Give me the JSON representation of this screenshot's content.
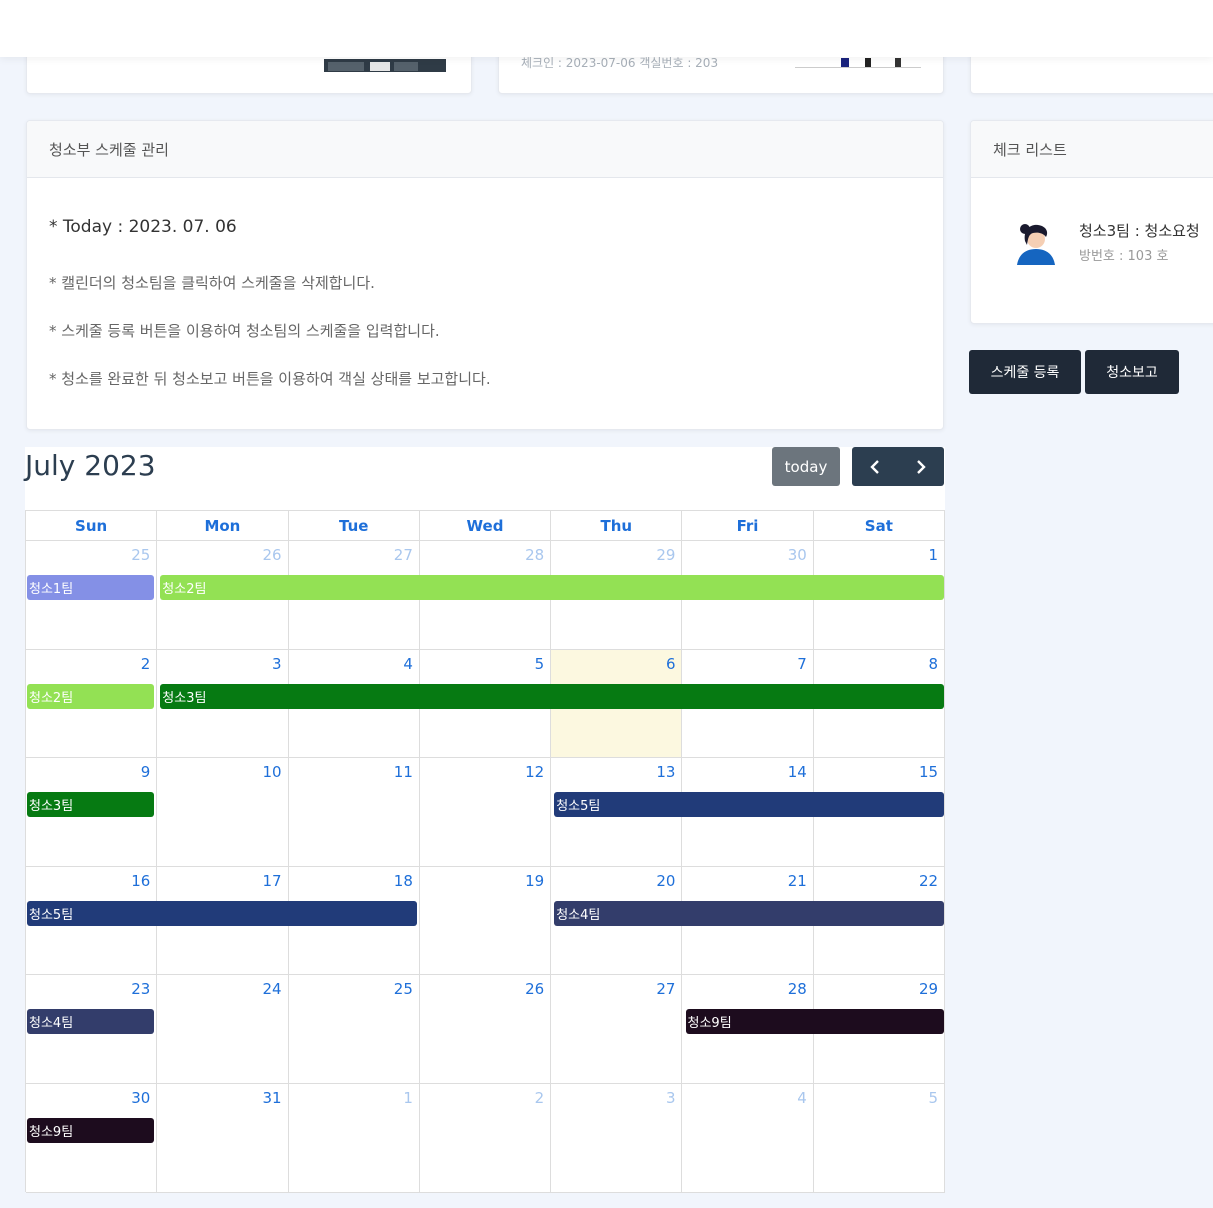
{
  "top_cards": {
    "card2_text": "체크인 : 2023-07-06 객실번호 : 203"
  },
  "schedule": {
    "header": "청소부 스케줄 관리",
    "today": "* Today : 2023. 07. 06",
    "info": [
      "* 캘린더의 청소팀을 클릭하여 스케줄을 삭제합니다.",
      "* 스케줄 등록 버튼을 이용하여 청소팀의 스케줄을 입력합니다.",
      "* 청소를 완료한 뒤 청소보고 버튼을 이용하여 객실 상태를 보고합니다."
    ]
  },
  "checklist": {
    "header": "체크 리스트",
    "item_title": "청소3팀 : 청소요청",
    "item_sub": "방번호 : 103 호"
  },
  "buttons": {
    "register": "스케줄 등록",
    "report": "청소보고"
  },
  "calendar": {
    "title": "July 2023",
    "today_label": "today",
    "prev_icon": "chevron-left-icon",
    "next_icon": "chevron-right-icon",
    "dow": [
      "Sun",
      "Mon",
      "Tue",
      "Wed",
      "Thu",
      "Fri",
      "Sat"
    ],
    "today_date": "2023-07-06",
    "weeks": [
      [
        {
          "d": "25",
          "other": true
        },
        {
          "d": "26",
          "other": true
        },
        {
          "d": "27",
          "other": true
        },
        {
          "d": "28",
          "other": true
        },
        {
          "d": "29",
          "other": true
        },
        {
          "d": "30",
          "other": true
        },
        {
          "d": "1"
        }
      ],
      [
        {
          "d": "2"
        },
        {
          "d": "3"
        },
        {
          "d": "4"
        },
        {
          "d": "5"
        },
        {
          "d": "6",
          "today": true
        },
        {
          "d": "7"
        },
        {
          "d": "8"
        }
      ],
      [
        {
          "d": "9"
        },
        {
          "d": "10"
        },
        {
          "d": "11"
        },
        {
          "d": "12"
        },
        {
          "d": "13"
        },
        {
          "d": "14"
        },
        {
          "d": "15"
        }
      ],
      [
        {
          "d": "16"
        },
        {
          "d": "17"
        },
        {
          "d": "18"
        },
        {
          "d": "19"
        },
        {
          "d": "20"
        },
        {
          "d": "21"
        },
        {
          "d": "22"
        }
      ],
      [
        {
          "d": "23"
        },
        {
          "d": "24"
        },
        {
          "d": "25"
        },
        {
          "d": "26"
        },
        {
          "d": "27"
        },
        {
          "d": "28"
        },
        {
          "d": "29"
        }
      ],
      [
        {
          "d": "30"
        },
        {
          "d": "31"
        },
        {
          "d": "1",
          "other": true
        },
        {
          "d": "2",
          "other": true
        },
        {
          "d": "3",
          "other": true
        },
        {
          "d": "4",
          "other": true
        },
        {
          "d": "5",
          "other": true
        }
      ]
    ],
    "events": [
      {
        "title": "청소1팀",
        "week": 0,
        "start": 0,
        "end": 0,
        "color": "#8490e6"
      },
      {
        "title": "청소2팀",
        "week": 0,
        "start": 1,
        "end": 6,
        "color": "#93e154"
      },
      {
        "title": "청소2팀",
        "week": 1,
        "start": 0,
        "end": 0,
        "color": "#93e154"
      },
      {
        "title": "청소3팀",
        "week": 1,
        "start": 1,
        "end": 6,
        "color": "#067a12"
      },
      {
        "title": "청소3팀",
        "week": 2,
        "start": 0,
        "end": 0,
        "color": "#067a12"
      },
      {
        "title": "청소5팀",
        "week": 2,
        "start": 4,
        "end": 6,
        "color": "#213b79"
      },
      {
        "title": "청소5팀",
        "week": 3,
        "start": 0,
        "end": 2,
        "color": "#213b79"
      },
      {
        "title": "청소4팀",
        "week": 3,
        "start": 4,
        "end": 6,
        "color": "#333d6b"
      },
      {
        "title": "청소4팀",
        "week": 4,
        "start": 0,
        "end": 0,
        "color": "#333d6b"
      },
      {
        "title": "청소9팀",
        "week": 4,
        "start": 5,
        "end": 6,
        "color": "#1d0c1e"
      },
      {
        "title": "청소9팀",
        "week": 5,
        "start": 0,
        "end": 0,
        "color": "#1d0c1e"
      }
    ]
  }
}
